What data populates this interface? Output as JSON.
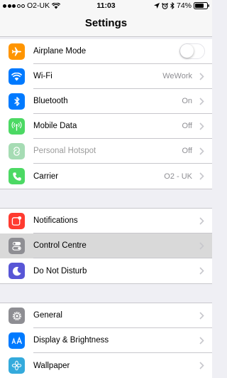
{
  "status_bar": {
    "carrier": "O2-UK",
    "time": "11:03",
    "battery": "74%"
  },
  "nav": {
    "title": "Settings"
  },
  "groups": [
    {
      "items": [
        {
          "label": "Airplane Mode",
          "icon": "airplane-icon",
          "color": "#ff9500",
          "toggle": false
        },
        {
          "label": "Wi-Fi",
          "value": "WeWork",
          "icon": "wifi-icon",
          "color": "#007aff"
        },
        {
          "label": "Bluetooth",
          "value": "On",
          "icon": "bluetooth-icon",
          "color": "#007aff"
        },
        {
          "label": "Mobile Data",
          "value": "Off",
          "icon": "antenna-icon",
          "color": "#4cd964"
        },
        {
          "label": "Personal Hotspot",
          "value": "Off",
          "icon": "hotspot-icon",
          "color": "#a6dcb4",
          "disabled": true
        },
        {
          "label": "Carrier",
          "value": "O2 - UK",
          "icon": "phone-icon",
          "color": "#4cd964"
        }
      ]
    },
    {
      "items": [
        {
          "label": "Notifications",
          "icon": "notifications-icon",
          "color": "#ff3b30"
        },
        {
          "label": "Control Centre",
          "icon": "switches-icon",
          "color": "#8e8e93",
          "highlighted": true
        },
        {
          "label": "Do Not Disturb",
          "icon": "moon-icon",
          "color": "#5856d6"
        }
      ]
    },
    {
      "items": [
        {
          "label": "General",
          "icon": "gear-icon",
          "color": "#8e8e93"
        },
        {
          "label": "Display & Brightness",
          "icon": "display-icon",
          "color": "#007aff"
        },
        {
          "label": "Wallpaper",
          "icon": "wallpaper-icon",
          "color": "#34aadc"
        }
      ]
    }
  ]
}
